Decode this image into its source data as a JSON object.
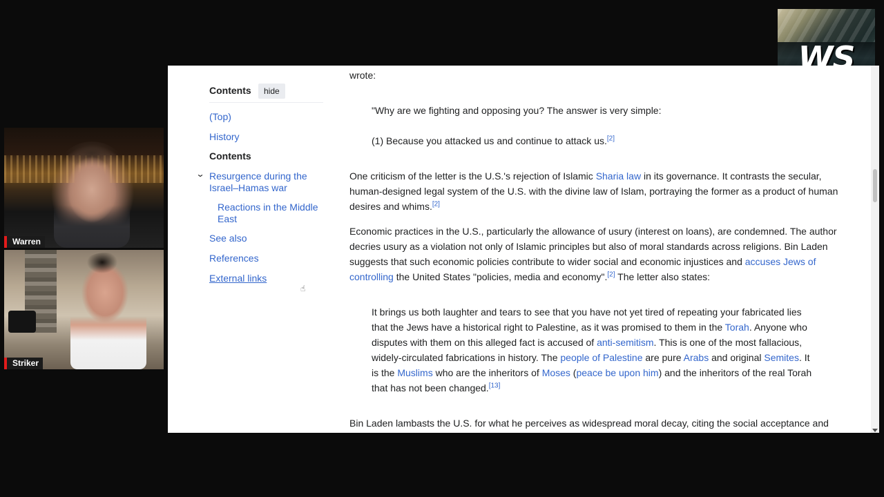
{
  "cams": [
    {
      "name": "Warren"
    },
    {
      "name": "Striker"
    }
  ],
  "logo": {
    "text": "WS"
  },
  "toc": {
    "title": "Contents",
    "hide_label": "hide",
    "items": [
      {
        "label": "(Top)"
      },
      {
        "label": "History"
      },
      {
        "label": "Contents"
      },
      {
        "label": "Resurgence during the Israel–Hamas war"
      },
      {
        "label": "Reactions in the Middle East"
      },
      {
        "label": "See also"
      },
      {
        "label": "References"
      },
      {
        "label": "External links"
      }
    ]
  },
  "article": {
    "wrote": "wrote:",
    "q1": "\"Why are we fighting and opposing you? The answer is very simple:",
    "q2": "(1) Because you attacked us and continue to attack us.",
    "ref2": "[2]",
    "ref13": "[13]",
    "p1_a": "One criticism of the letter is the U.S.'s rejection of Islamic ",
    "p1_link": "Sharia law",
    "p1_b": " in its governance. It contrasts the secular, human-designed legal system of the U.S. with the divine law of Islam, portraying the former as a product of human desires and whims.",
    "p2_a": "Economic practices in the U.S., particularly the allowance of usury (interest on loans), are condemned. The author decries usury as a violation not only of Islamic principles but also of moral standards across religions. Bin Laden suggests that such economic policies contribute to wider social and economic injustices and ",
    "p2_link": "accuses Jews of controlling",
    "p2_b": " the United States \"policies, media and economy\".",
    "p2_c": " The letter also states:",
    "q3_a": "It brings us both laughter and tears to see that you have not yet tired of repeating your fabricated lies that the Jews have a historical right to Palestine, as it was promised to them in the ",
    "q3_torah": "Torah",
    "q3_b": ". Anyone who disputes with them on this alleged fact is accused of ",
    "q3_antisem": "anti-semitism",
    "q3_c": ". This is one of the most fallacious, widely-circulated fabrications in history. The ",
    "q3_pal": "people of Palestine",
    "q3_d": " are pure ",
    "q3_arabs": "Arabs",
    "q3_e": " and original ",
    "q3_semites": "Semites",
    "q3_f": ". It is the ",
    "q3_muslims": "Muslims",
    "q3_g": " who are the inheritors of ",
    "q3_moses": "Moses",
    "q3_h": " (",
    "q3_pbuh": "peace be upon him",
    "q3_i": ") and the inheritors of the real Torah that has not been changed.",
    "p3": "Bin Laden lambasts the U.S. for what he perceives as widespread moral decay, citing the social acceptance and"
  }
}
